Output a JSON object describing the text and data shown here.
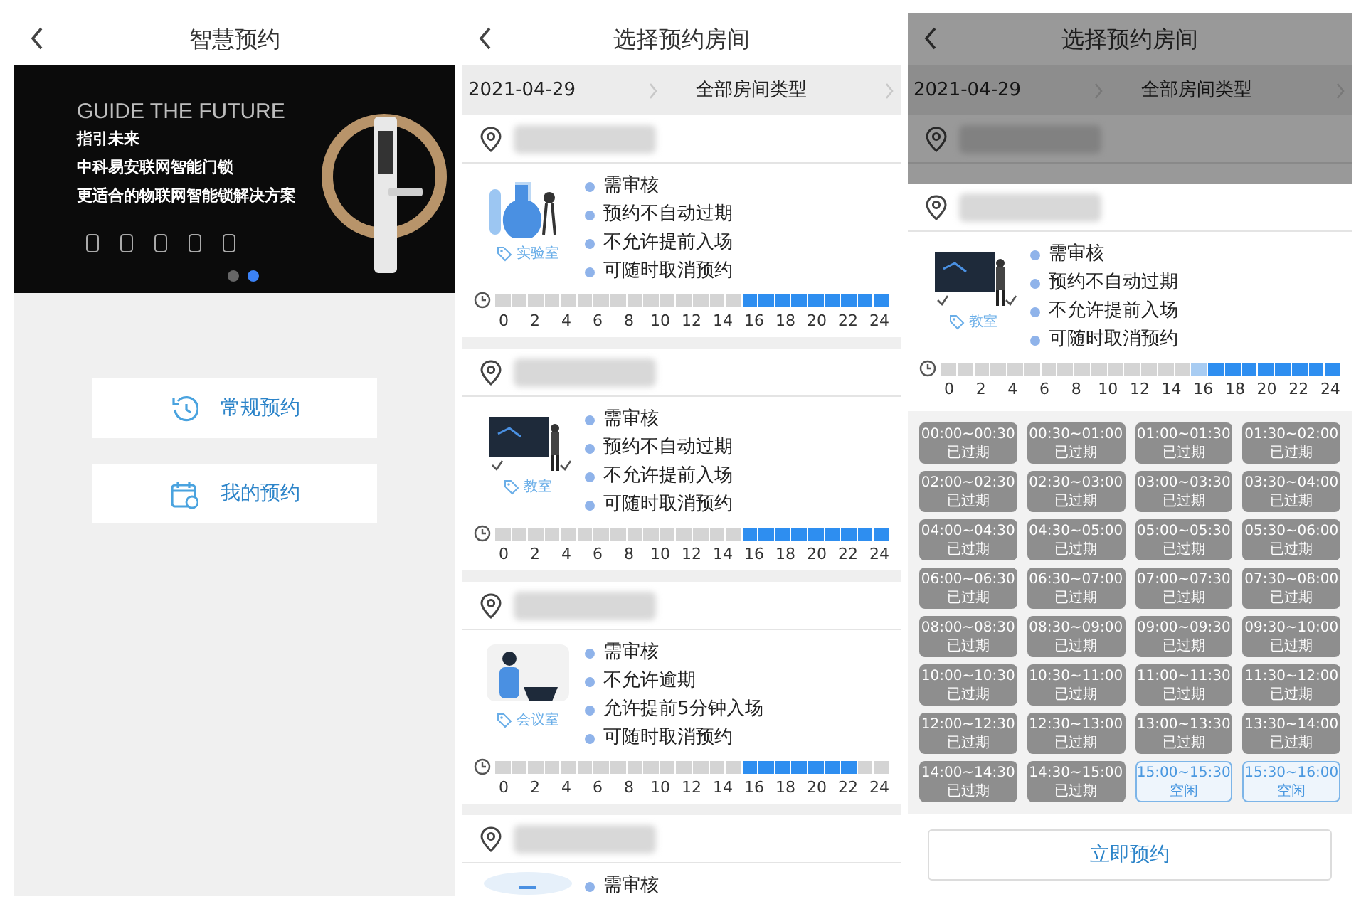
{
  "home_screen": {
    "title": "智慧预约",
    "banner": {
      "headline": "GUIDE THE FUTURE",
      "lines": [
        "指引未来",
        "中科易安联网智能门锁",
        "更适合的物联网智能锁解决方案"
      ],
      "dots": [
        {
          "selected": false
        },
        {
          "selected": true
        }
      ]
    },
    "menu": [
      {
        "kind": "history",
        "label": "常规预约"
      },
      {
        "kind": "calendar",
        "label": "我的预约"
      }
    ]
  },
  "room_list_screen": {
    "title": "选择预约房间",
    "date": "2021-04-29",
    "room_type": "全部房间类型",
    "rooms": [
      {
        "kind": "lab",
        "tag": "实验室",
        "rules": [
          "需审核",
          "预约不自动过期",
          "不允许提前入场",
          "可随时取消预约"
        ],
        "timeline": {
          "free": [
            false,
            false,
            false,
            false,
            false,
            false,
            false,
            false,
            false,
            false,
            false,
            false,
            false,
            false,
            false,
            true,
            true,
            true,
            true,
            true,
            true,
            true,
            true,
            true
          ],
          "labels": [
            "0",
            "2",
            "4",
            "6",
            "8",
            "10",
            "12",
            "14",
            "16",
            "18",
            "20",
            "22",
            "24"
          ]
        }
      },
      {
        "kind": "classroom",
        "tag": "教室",
        "rules": [
          "需审核",
          "预约不自动过期",
          "不允许提前入场",
          "可随时取消预约"
        ],
        "timeline": {
          "free": [
            false,
            false,
            false,
            false,
            false,
            false,
            false,
            false,
            false,
            false,
            false,
            false,
            false,
            false,
            false,
            true,
            true,
            true,
            true,
            true,
            true,
            true,
            true,
            true
          ],
          "labels": [
            "0",
            "2",
            "4",
            "6",
            "8",
            "10",
            "12",
            "14",
            "16",
            "18",
            "20",
            "22",
            "24"
          ]
        }
      },
      {
        "kind": "meeting",
        "tag": "会议室",
        "rules": [
          "需审核",
          "不允许逾期",
          "允许提前5分钟入场",
          "可随时取消预约"
        ],
        "timeline": {
          "free": [
            false,
            false,
            false,
            false,
            false,
            false,
            false,
            false,
            false,
            false,
            false,
            false,
            false,
            false,
            false,
            true,
            true,
            true,
            true,
            true,
            true,
            true,
            false,
            false
          ],
          "labels": [
            "0",
            "2",
            "4",
            "6",
            "8",
            "10",
            "12",
            "14",
            "16",
            "18",
            "20",
            "22",
            "24"
          ]
        }
      },
      {
        "kind": "partial",
        "rules": [
          "需审核"
        ]
      }
    ]
  },
  "booking_screen": {
    "title": "选择预约房间",
    "date": "2021-04-29",
    "room_type": "全部房间类型",
    "room": {
      "kind": "classroom",
      "tag": "教室",
      "rules": [
        "需审核",
        "预约不自动过期",
        "不允许提前入场",
        "可随时取消预约"
      ],
      "timeline": {
        "free": [
          false,
          false,
          false,
          false,
          false,
          false,
          false,
          false,
          false,
          false,
          false,
          false,
          false,
          false,
          false,
          true,
          true,
          true,
          true,
          true,
          true,
          true,
          true,
          true
        ],
        "selected": [
          false,
          false,
          false,
          false,
          false,
          false,
          false,
          false,
          false,
          false,
          false,
          false,
          false,
          false,
          false,
          true,
          false,
          false,
          false,
          false,
          false,
          false,
          false,
          false
        ],
        "labels": [
          "0",
          "2",
          "4",
          "6",
          "8",
          "10",
          "12",
          "14",
          "16",
          "18",
          "20",
          "22",
          "24"
        ]
      }
    },
    "slots": [
      {
        "kind": "expired",
        "time": "00:00~00:30",
        "status": "已过期"
      },
      {
        "kind": "expired",
        "time": "00:30~01:00",
        "status": "已过期"
      },
      {
        "kind": "expired",
        "time": "01:00~01:30",
        "status": "已过期"
      },
      {
        "kind": "expired",
        "time": "01:30~02:00",
        "status": "已过期"
      },
      {
        "kind": "expired",
        "time": "02:00~02:30",
        "status": "已过期"
      },
      {
        "kind": "expired",
        "time": "02:30~03:00",
        "status": "已过期"
      },
      {
        "kind": "expired",
        "time": "03:00~03:30",
        "status": "已过期"
      },
      {
        "kind": "expired",
        "time": "03:30~04:00",
        "status": "已过期"
      },
      {
        "kind": "expired",
        "time": "04:00~04:30",
        "status": "已过期"
      },
      {
        "kind": "expired",
        "time": "04:30~05:00",
        "status": "已过期"
      },
      {
        "kind": "expired",
        "time": "05:00~05:30",
        "status": "已过期"
      },
      {
        "kind": "expired",
        "time": "05:30~06:00",
        "status": "已过期"
      },
      {
        "kind": "expired",
        "time": "06:00~06:30",
        "status": "已过期"
      },
      {
        "kind": "expired",
        "time": "06:30~07:00",
        "status": "已过期"
      },
      {
        "kind": "expired",
        "time": "07:00~07:30",
        "status": "已过期"
      },
      {
        "kind": "expired",
        "time": "07:30~08:00",
        "status": "已过期"
      },
      {
        "kind": "expired",
        "time": "08:00~08:30",
        "status": "已过期"
      },
      {
        "kind": "expired",
        "time": "08:30~09:00",
        "status": "已过期"
      },
      {
        "kind": "expired",
        "time": "09:00~09:30",
        "status": "已过期"
      },
      {
        "kind": "expired",
        "time": "09:30~10:00",
        "status": "已过期"
      },
      {
        "kind": "expired",
        "time": "10:00~10:30",
        "status": "已过期"
      },
      {
        "kind": "expired",
        "time": "10:30~11:00",
        "status": "已过期"
      },
      {
        "kind": "expired",
        "time": "11:00~11:30",
        "status": "已过期"
      },
      {
        "kind": "expired",
        "time": "11:30~12:00",
        "status": "已过期"
      },
      {
        "kind": "expired",
        "time": "12:00~12:30",
        "status": "已过期"
      },
      {
        "kind": "expired",
        "time": "12:30~13:00",
        "status": "已过期"
      },
      {
        "kind": "expired",
        "time": "13:00~13:30",
        "status": "已过期"
      },
      {
        "kind": "expired",
        "time": "13:30~14:00",
        "status": "已过期"
      },
      {
        "kind": "expired",
        "time": "14:00~14:30",
        "status": "已过期"
      },
      {
        "kind": "expired",
        "time": "14:30~15:00",
        "status": "已过期"
      },
      {
        "kind": "free",
        "time": "15:00~15:30",
        "status": "空闲"
      },
      {
        "kind": "free",
        "time": "15:30~16:00",
        "status": "空闲"
      }
    ],
    "book_button": "立即预约"
  }
}
